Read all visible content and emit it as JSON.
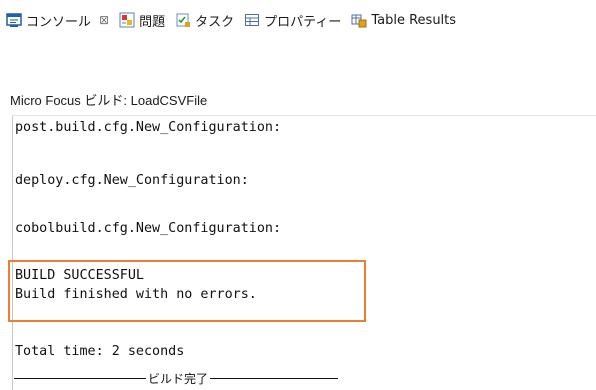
{
  "tabs": [
    {
      "label": "コンソール",
      "icon": "console-icon",
      "close": "⊠"
    },
    {
      "label": "問題",
      "icon": "problems-icon"
    },
    {
      "label": "タスク",
      "icon": "tasks-icon"
    },
    {
      "label": "プロパティー",
      "icon": "properties-icon"
    },
    {
      "label": "Table Results",
      "icon": "table-results-icon"
    }
  ],
  "console": {
    "title": "Micro Focus ビルド: LoadCSVFile",
    "lines": [
      "post.build.cfg.New_Configuration:",
      "deploy.cfg.New_Configuration:",
      "cobolbuild.cfg.New_Configuration:",
      "BUILD SUCCESSFUL",
      "Build finished with no errors.",
      "Total time: 2 seconds"
    ],
    "end_marker": "ビルド完了"
  },
  "colors": {
    "highlight": "#ed7d31",
    "accent": "#1f5fa8"
  }
}
